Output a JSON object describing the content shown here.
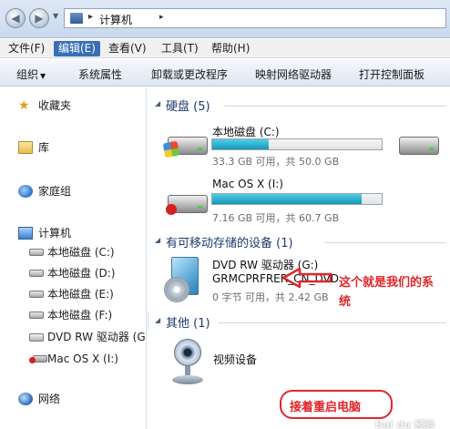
{
  "address": {
    "breadcrumb": "计算机"
  },
  "menubar": {
    "items": [
      {
        "label": "文件(F)",
        "active": false
      },
      {
        "label": "编辑(E)",
        "active": true
      },
      {
        "label": "查看(V)",
        "active": false
      },
      {
        "label": "工具(T)",
        "active": false
      },
      {
        "label": "帮助(H)",
        "active": false
      }
    ]
  },
  "commandbar": {
    "items": [
      {
        "label": "组织"
      },
      {
        "label": "系统属性"
      },
      {
        "label": "卸载或更改程序"
      },
      {
        "label": "映射网络驱动器"
      },
      {
        "label": "打开控制面板"
      }
    ]
  },
  "navpane": {
    "favorites": "收藏夹",
    "libraries": "库",
    "homegroup": "家庭组",
    "computer": "计算机",
    "drives": [
      {
        "label": "本地磁盘 (C:)",
        "icon": "drive-icon"
      },
      {
        "label": "本地磁盘 (D:)",
        "icon": "drive-icon"
      },
      {
        "label": "本地磁盘 (E:)",
        "icon": "drive-icon"
      },
      {
        "label": "本地磁盘 (F:)",
        "icon": "drive-icon"
      },
      {
        "label": "DVD RW 驱动器 (G",
        "icon": "dvd-drive-icon"
      },
      {
        "label": "Mac OS X (I:)",
        "icon": "mac-drive-icon"
      }
    ],
    "network": "网络"
  },
  "content": {
    "hard_disks": {
      "title": "硬盘 (5)",
      "drives": [
        {
          "name": "本地磁盘 (C:)",
          "free": "33.3 GB 可用，共 50.0 GB",
          "used_fraction": 0.334
        },
        {
          "name": "Mac OS X (I:)",
          "free": "7.16 GB 可用，共 60.7 GB",
          "used_fraction": 0.882
        }
      ]
    },
    "removable": {
      "title": "有可移动存储的设备 (1)",
      "device_name": "DVD RW 驱动器 (G:)",
      "device_label": "GRMCPRFRER_CN_DVD",
      "free": "0 字节 可用，共 2.42 GB"
    },
    "other": {
      "title": "其他 (1)",
      "device_name": "视频设备"
    }
  },
  "annotations": {
    "note": "这个就是我们的系",
    "note_cont": "统",
    "restart": "接着重启电脑",
    "watermark": "Bai du 经验"
  },
  "colors": {
    "accent_red": "#e0262a",
    "bar_fill": "#1996b6",
    "menu_active": "#3a6fb8"
  }
}
